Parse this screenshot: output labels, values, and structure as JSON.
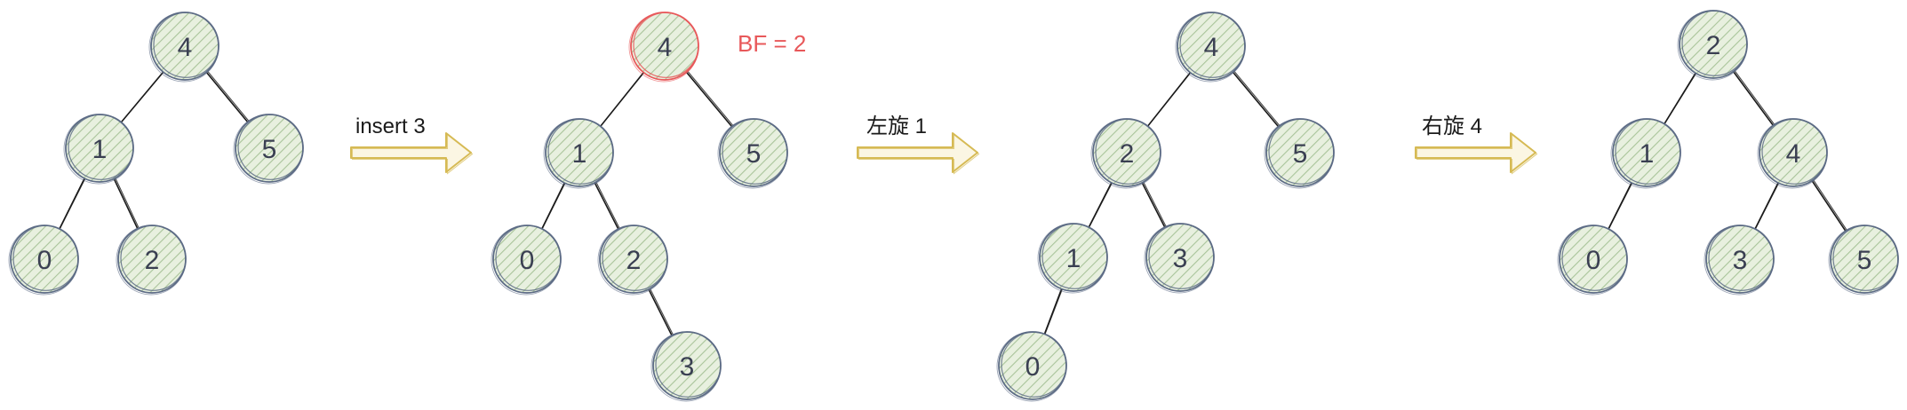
{
  "colors": {
    "node_fill": "#cfe0c0",
    "node_hatch": "#a9c49a",
    "node_stroke": "#5c6b85",
    "node_highlight_stroke": "#e8585a",
    "edge": "#1a1a1a",
    "arrow": "#d6ba54",
    "bf_text": "#e8585a",
    "text": "#3a3f52"
  },
  "trees": [
    {
      "nodes": [
        {
          "id": "t1-4",
          "label": "4"
        },
        {
          "id": "t1-1",
          "label": "1"
        },
        {
          "id": "t1-5",
          "label": "5"
        },
        {
          "id": "t1-0",
          "label": "0"
        },
        {
          "id": "t1-2",
          "label": "2"
        }
      ]
    },
    {
      "nodes": [
        {
          "id": "t2-4",
          "label": "4",
          "highlight": true
        },
        {
          "id": "t2-1",
          "label": "1"
        },
        {
          "id": "t2-5",
          "label": "5"
        },
        {
          "id": "t2-0",
          "label": "0"
        },
        {
          "id": "t2-2",
          "label": "2"
        },
        {
          "id": "t2-3",
          "label": "3"
        }
      ],
      "annotation": "BF = 2"
    },
    {
      "nodes": [
        {
          "id": "t3-4",
          "label": "4"
        },
        {
          "id": "t3-2",
          "label": "2"
        },
        {
          "id": "t3-5",
          "label": "5"
        },
        {
          "id": "t3-1",
          "label": "1"
        },
        {
          "id": "t3-3",
          "label": "3"
        },
        {
          "id": "t3-0",
          "label": "0"
        }
      ]
    },
    {
      "nodes": [
        {
          "id": "t4-2",
          "label": "2"
        },
        {
          "id": "t4-1",
          "label": "1"
        },
        {
          "id": "t4-4",
          "label": "4"
        },
        {
          "id": "t4-0",
          "label": "0"
        },
        {
          "id": "t4-3",
          "label": "3"
        },
        {
          "id": "t4-5",
          "label": "5"
        }
      ]
    }
  ],
  "operations": [
    {
      "label": "insert 3"
    },
    {
      "label": "左旋 1"
    },
    {
      "label": "右旋 4"
    }
  ]
}
